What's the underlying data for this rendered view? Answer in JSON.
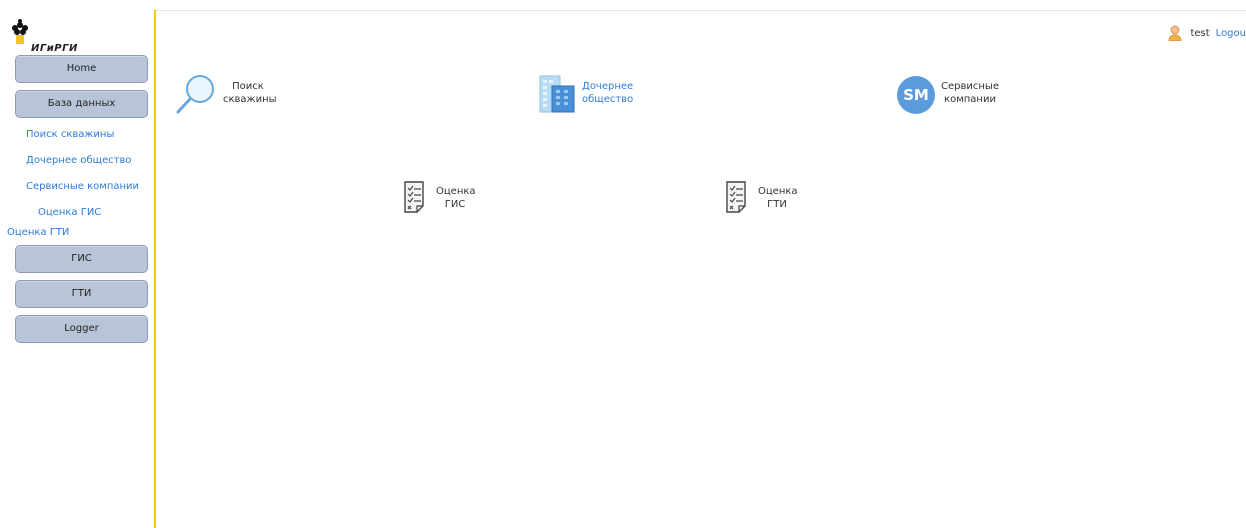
{
  "logo": {
    "text": "ИГиРГИ",
    "icon": "flame-icon"
  },
  "user": {
    "name": "test",
    "logout_label": "Logou",
    "icon": "user-avatar-icon"
  },
  "sidebar": {
    "buttons": {
      "home": "Home",
      "database": "База данных",
      "gis": "ГИС",
      "gti": "ГТИ",
      "logger": "Logger"
    },
    "links": {
      "well_search": "Поиск скважины",
      "subsidiary": "Дочернее общество",
      "service_companies": "Сервисные компании",
      "gis_eval": "Оценка ГИС",
      "gti_eval": "Оценка ГТИ"
    }
  },
  "tiles": {
    "well_search": {
      "line1": "Поиск",
      "line2": "скважины",
      "icon": "magnifier-icon"
    },
    "subsidiary": {
      "line1": "Дочернее",
      "line2": "общество",
      "icon": "building-icon"
    },
    "service_companies": {
      "line1": "Сервисные",
      "line2": "компании",
      "icon": "sm-badge-icon",
      "badge_text": "SM"
    },
    "gis_eval": {
      "line1": "Оценка",
      "line2": "ГИС",
      "icon": "checklist-icon"
    },
    "gti_eval": {
      "line1": "Оценка",
      "line2": "ГТИ",
      "icon": "checklist-icon"
    }
  },
  "colors": {
    "sidebar_border": "#f5c518",
    "button_bg": "#b8c4d8",
    "link": "#2b7bd6",
    "badge": "#5b9bdb"
  }
}
